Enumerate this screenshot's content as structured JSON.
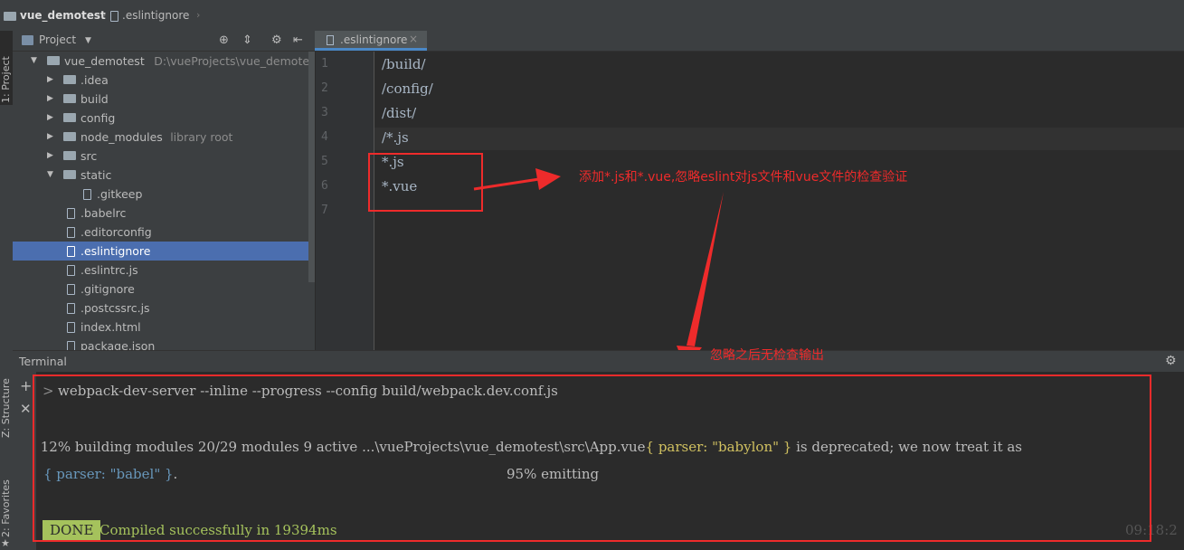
{
  "navbar": {
    "project": "vue_demotest",
    "file": ".eslintignore"
  },
  "left_strip": {
    "project_tab": "1: Project",
    "structure_tab": "Z: Structure",
    "favorites_tab": "2: Favorites"
  },
  "project_panel": {
    "title": "Project",
    "tree": [
      {
        "label": "vue_demotest",
        "hint": "D:\\vueProjects\\vue_demotest",
        "type": "folder",
        "expanded": true
      },
      {
        "label": ".idea",
        "hint": "",
        "type": "folder",
        "expanded": false
      },
      {
        "label": "build",
        "hint": "",
        "type": "folder",
        "expanded": false
      },
      {
        "label": "config",
        "hint": "",
        "type": "folder",
        "expanded": false
      },
      {
        "label": "node_modules",
        "hint": "library root",
        "type": "folder",
        "expanded": false
      },
      {
        "label": "src",
        "hint": "",
        "type": "folder",
        "expanded": false
      },
      {
        "label": "static",
        "hint": "",
        "type": "folder",
        "expanded": true
      },
      {
        "label": ".gitkeep",
        "hint": "",
        "type": "file"
      },
      {
        "label": ".babelrc",
        "hint": "",
        "type": "file"
      },
      {
        "label": ".editorconfig",
        "hint": "",
        "type": "file"
      },
      {
        "label": ".eslintignore",
        "hint": "",
        "type": "file",
        "selected": true
      },
      {
        "label": ".eslintrc.js",
        "hint": "",
        "type": "file"
      },
      {
        "label": ".gitignore",
        "hint": "",
        "type": "file"
      },
      {
        "label": ".postcssrc.js",
        "hint": "",
        "type": "file"
      },
      {
        "label": "index.html",
        "hint": "",
        "type": "file"
      },
      {
        "label": "package.json",
        "hint": "",
        "type": "file"
      }
    ]
  },
  "editor": {
    "tab_label": ".eslintignore",
    "line_numbers": [
      "1",
      "2",
      "3",
      "4",
      "5",
      "6",
      "7"
    ],
    "lines": [
      "/build/",
      "/config/",
      "/dist/",
      "/*.js",
      "*.js",
      "*.vue",
      ""
    ]
  },
  "annotations": {
    "note_top": "添加*.js和*.vue,忽略eslint对js文件和vue文件的检查验证",
    "note_bottom": "忽略之后无检查输出",
    "color": "#ee2b2b"
  },
  "terminal": {
    "title": "Terminal",
    "command": "webpack-dev-server --inline --progress --config build/webpack.dev.conf.js",
    "progress_text": " 12% building modules 20/29 modules 9 active ...\\vueProjects\\vue_demotest\\src\\App.vue",
    "warn_part1": "{ parser: \"babylon\" }",
    "warn_middle": " is deprecated; we now treat it as",
    "warn_part2": "{ parser: \"babel\" }",
    "warn_end": ".",
    "emitting": "95% emitting",
    "done_badge": "DONE",
    "success_msg": "Compiled successfully in 19394ms",
    "clock": "09:18:2"
  }
}
